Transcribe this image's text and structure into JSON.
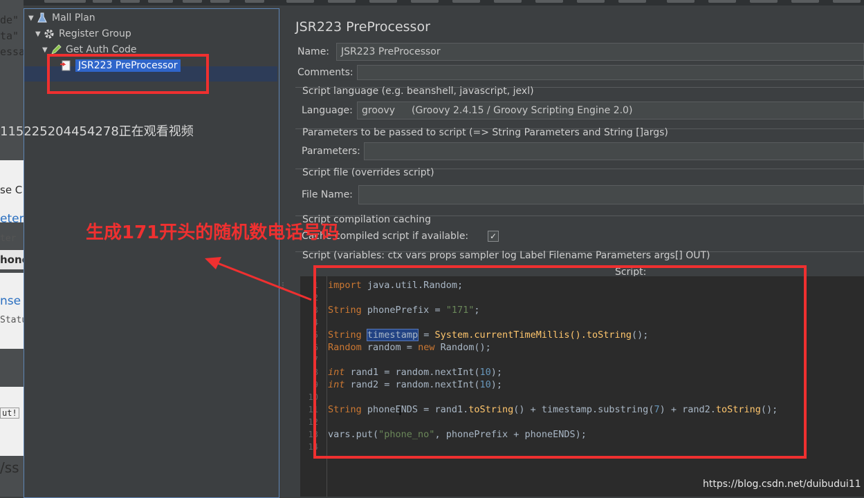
{
  "left_fragments": [
    "de\"",
    "ta\"",
    "essag",
    "se C",
    "eter",
    "ter",
    "hone",
    "nse",
    "Statu",
    "ut!",
    "/ss"
  ],
  "tree": {
    "items": [
      {
        "label": "Mall Plan",
        "icon": "test-plan-icon"
      },
      {
        "label": "Register Group",
        "icon": "gear-icon"
      },
      {
        "label": "Get Auth Code",
        "icon": "sampler-pencil-icon"
      },
      {
        "label": "JSR223 PreProcessor",
        "icon": "preprocessor-icon"
      }
    ]
  },
  "panel": {
    "title": "JSR223 PreProcessor",
    "name_label": "Name:",
    "name_value": "JSR223 PreProcessor",
    "comments_label": "Comments:",
    "script_language_group": "Script language (e.g. beanshell, javascript, jexl)",
    "language_label": "Language:",
    "language_value": "groovy",
    "language_desc": "(Groovy 2.4.15 / Groovy Scripting Engine 2.0)",
    "parameters_group": "Parameters to be passed to script (=> String Parameters and String []args)",
    "parameters_label": "Parameters:",
    "script_file_group": "Script file (overrides script)",
    "file_name_label": "File Name:",
    "caching_group": "Script compilation caching",
    "cache_label": "Cache compiled script if available:",
    "cache_checked": "✓",
    "script_group": "Script (variables: ctx vars props sampler log Label Filename Parameters args[] OUT)",
    "script_header": "Script:"
  },
  "code": {
    "line_numbers": [
      "1",
      "2",
      "3",
      "4",
      "5",
      "6",
      "7",
      "8",
      "9",
      "10",
      "11",
      "12",
      "13",
      "14"
    ],
    "l1_kw": "import",
    "l1_rest": " java.util.Random;",
    "l3_type": "String",
    "l3_mid": " phonePrefix = ",
    "l3_str": "\"171\"",
    "l3_end": ";",
    "l5_type": "String",
    "l5_var": "timestamp",
    "l5_mid": " = ",
    "l5_sys": "System.currentTimeMillis().",
    "l5_mth": "toString",
    "l5_end": "();",
    "l6_type": "Random",
    "l6_mid": " random = ",
    "l6_new": "new",
    "l6_end": " Random();",
    "l8_kw": "int",
    "l8_mid": " rand1 = random.nextInt(",
    "l8_num": "10",
    "l8_end": ");",
    "l9_kw": "int",
    "l9_mid": " rand2 = random.nextInt(",
    "l9_num": "10",
    "l9_end": ");",
    "l11_type": "String",
    "l11_a": " phoneENDS = rand1.",
    "l11_m1": "toString",
    "l11_b": "() + timestamp.substring(",
    "l11_num": "7",
    "l11_c": ") + rand2.",
    "l11_m2": "toString",
    "l11_d": "();",
    "l13_a": "vars.put(",
    "l13_str": "\"phone_no\"",
    "l13_b": ", phonePrefix + phoneENDS);"
  },
  "overlay": {
    "viewer_watermark": "115225204454278正在观看视频",
    "annotation": "生成171开头的随机数电话号码",
    "csdn_watermark": "https://blog.csdn.net/duibudui11",
    "annotation_color": "#ef3030"
  }
}
